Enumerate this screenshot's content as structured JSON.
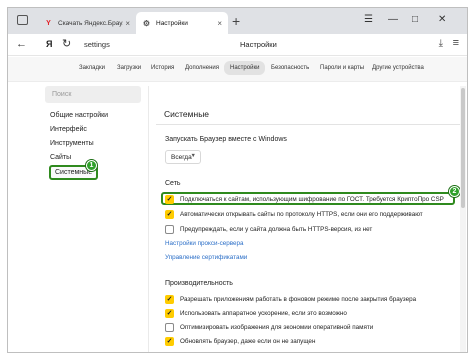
{
  "tabs": [
    {
      "label": "Скачать Яндекс.Браузер д",
      "close": "×",
      "favicon": "yandex-y"
    },
    {
      "label": "Настройки",
      "close": "×",
      "favicon": "gear"
    }
  ],
  "new_tab_label": "+",
  "address_bar": {
    "back": "←",
    "logo": "Я",
    "reload": "↻",
    "url": "settings",
    "page_title": "Настройки",
    "menu": "≡",
    "download": "⤓"
  },
  "window_controls": {
    "minimize": "—",
    "maximize": "□",
    "close": "✕",
    "bookmarks": "☰"
  },
  "settings_nav": [
    "Закладки",
    "Загрузки",
    "История",
    "Дополнения",
    "Настройки",
    "Безопасность",
    "Пароли и карты",
    "Другие устройства"
  ],
  "settings_nav_active": "Настройки",
  "sidebar": {
    "search_placeholder": "Поиск",
    "items": [
      "Общие настройки",
      "Интерфейс",
      "Инструменты",
      "Сайты",
      "Системные"
    ],
    "active": "Системные",
    "badge": "1"
  },
  "main": {
    "section_title": "Системные",
    "launch_label": "Запускать Браузер вместе с Windows",
    "launch_value": "Всегда",
    "network_title": "Сеть",
    "network_options": [
      {
        "label": "Подключаться к сайтам, использующим шифрование по ГОСТ. Требуется КриптоПро CSP",
        "checked": true
      },
      {
        "label": "Автоматически открывать сайты по протоколу HTTPS, если они его поддерживают",
        "checked": true
      },
      {
        "label": "Предупреждать, если у сайта должна быть HTTPS-версия, из нет",
        "checked": false
      }
    ],
    "highlight_badge": "2",
    "links": [
      "Настройки прокси-сервера",
      "Управление сертификатами"
    ],
    "perf_title": "Производительность",
    "perf_options": [
      {
        "label": "Разрешать приложениям работать в фоновом режиме после закрытия браузера",
        "checked": true
      },
      {
        "label": "Использовать аппаратное ускорение, если это возможно",
        "checked": true
      },
      {
        "label": "Оптимизировать изображения для экономии оперативной памяти",
        "checked": false
      },
      {
        "label": "Обновлять браузер, даже если он не запущен",
        "checked": true
      }
    ]
  },
  "colors": {
    "accent_check": "#ffcc00",
    "highlight": "#2f8a1e",
    "link": "#2a6ec7"
  }
}
